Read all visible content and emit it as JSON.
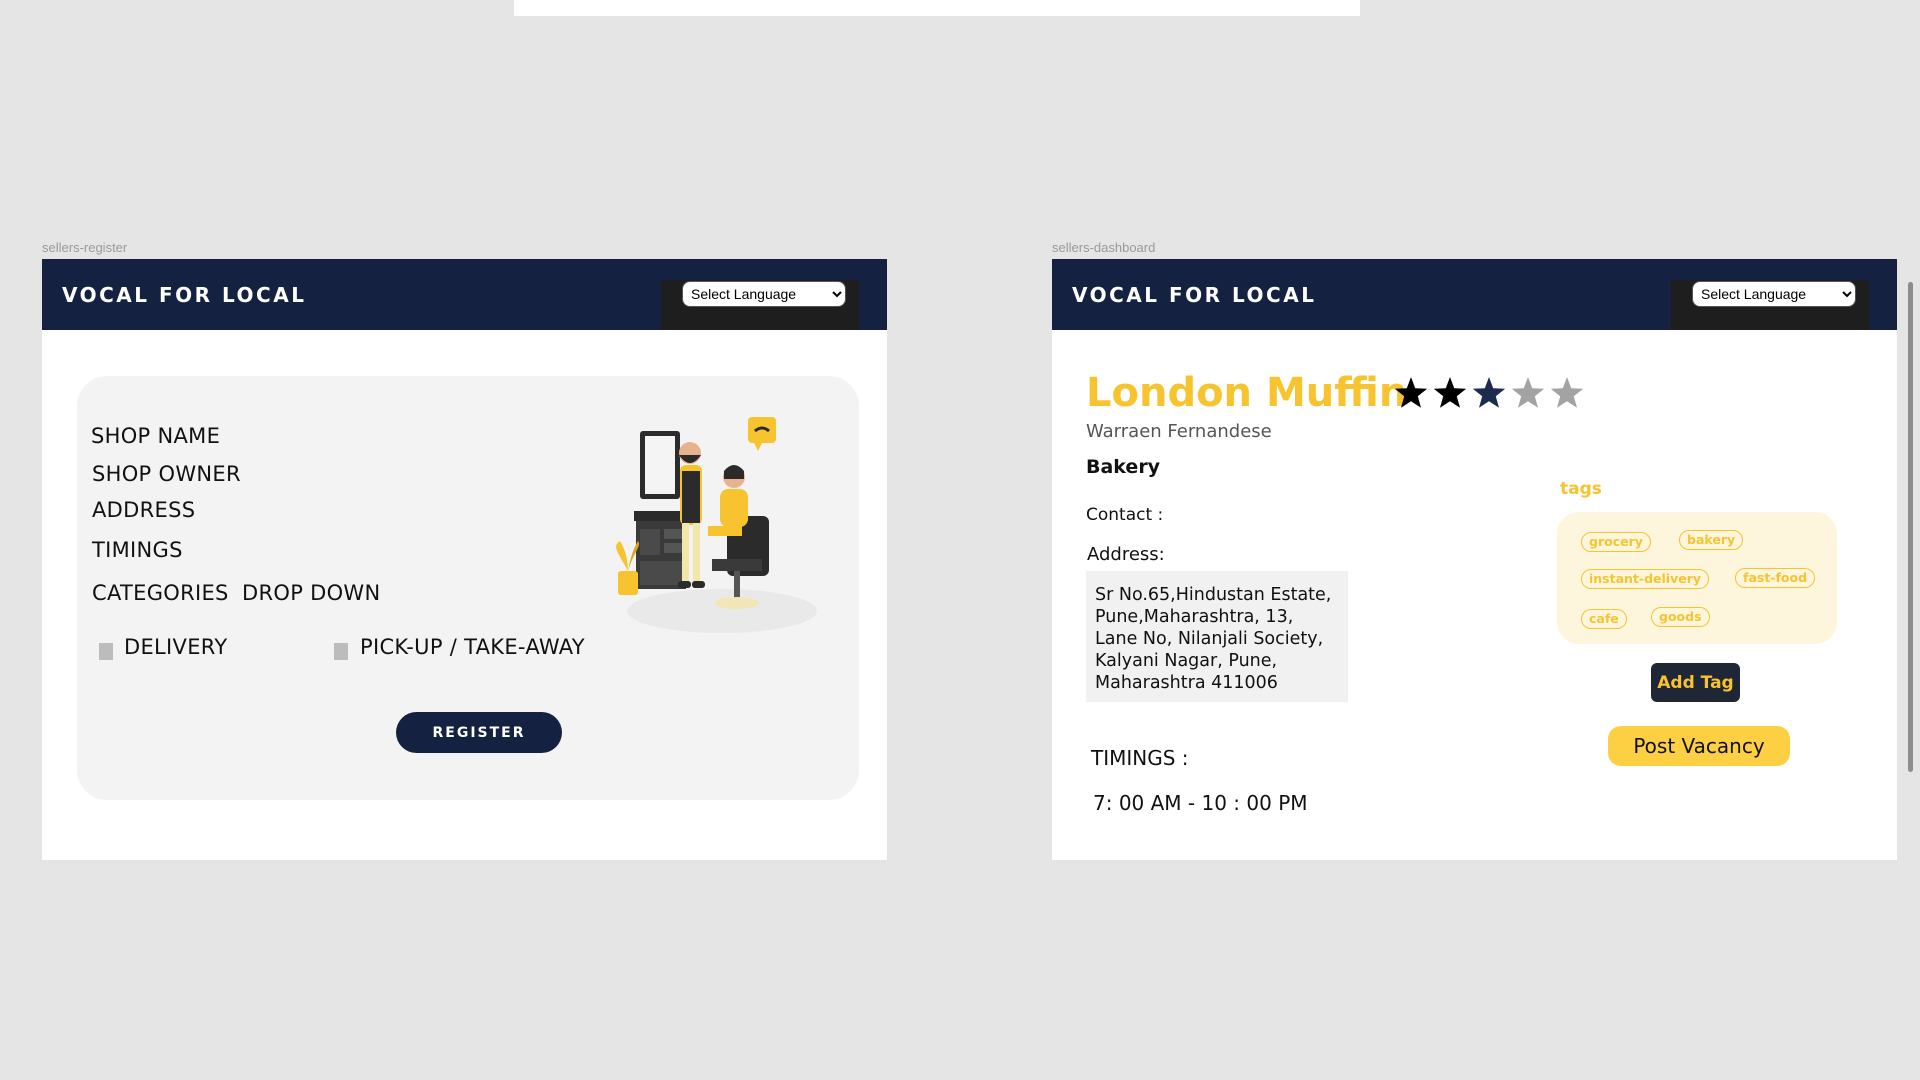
{
  "register_frame": {
    "label": "sellers-register",
    "brand": "VOCAL FOR LOCAL",
    "language_select": {
      "selected": "Select Language"
    },
    "fields": {
      "shop_name": "SHOP NAME",
      "shop_owner": "SHOP OWNER",
      "address": "ADDRESS",
      "timings": "TIMINGS",
      "categories": "CATEGORIES",
      "categories_dropdown": "DROP DOWN"
    },
    "options": {
      "delivery": "DELIVERY",
      "pickup": "PICK-UP / TAKE-AWAY"
    },
    "register_button": "REGISTER"
  },
  "dashboard_frame": {
    "label": "sellers-dashboard",
    "brand": "VOCAL FOR LOCAL",
    "language_select": {
      "selected": "Select Language"
    },
    "shop_name": "London Muffin",
    "rating": {
      "value": 3,
      "max": 5
    },
    "owner": "Warraen Fernandese",
    "category": "Bakery",
    "contact_label": "Contact :",
    "address_label": "Address:",
    "address": "Sr No.65,Hindustan Estate, Pune,Maharashtra, 13, Lane No, Nilanjali Society, Kalyani Nagar, Pune, Maharashtra 411006",
    "timings_label": "TIMINGS :",
    "timings_value": "7: 00 AM - 10 : 00 PM",
    "tags_label": "tags",
    "tags": [
      "grocery",
      "bakery",
      "instant-delivery",
      "fast-food",
      "cafe",
      "goods"
    ],
    "add_tag_button": "Add Tag",
    "post_vacancy_button": "Post Vacancy"
  },
  "colors": {
    "navbar": "#142140",
    "accent_yellow": "#f7c430",
    "canvas_bg": "#e5e5e5"
  }
}
